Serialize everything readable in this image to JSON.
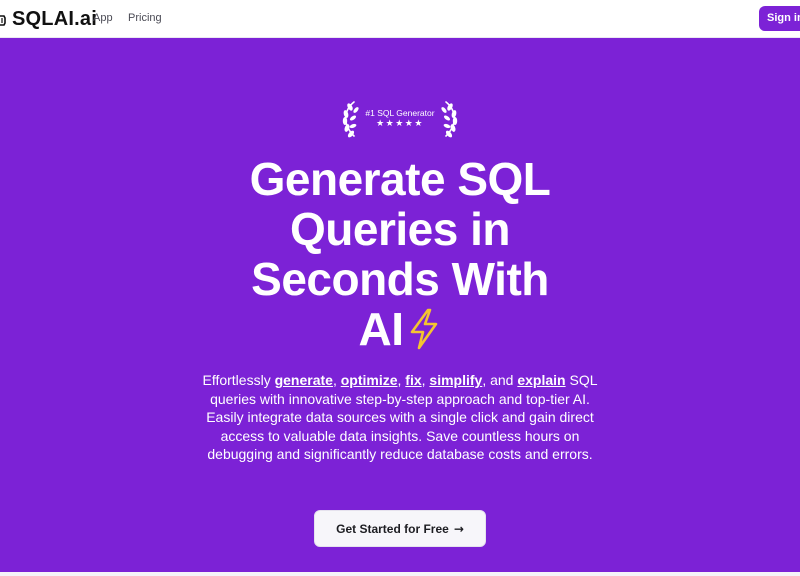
{
  "nav": {
    "brand": "SQLAI.ai",
    "links": [
      {
        "label": "App"
      },
      {
        "label": "Pricing"
      }
    ],
    "signin_label": "Sign in",
    "icons": {
      "brand": "logo-icon"
    }
  },
  "hero": {
    "award_label": "#1 SQL Generator",
    "award_stars": "★★★★★",
    "headline_lines": [
      "Generate SQL",
      "Queries in",
      "Seconds With",
      "AI"
    ],
    "headline_icon": "lightning-bolt-icon",
    "description": {
      "prefix": "Effortlessly ",
      "k1": "generate",
      "sep1": ", ",
      "k2": "optimize",
      "sep2": ", ",
      "k3": "fix",
      "sep3": ", ",
      "k4": "simplify",
      "sep4": ", and ",
      "k5": "explain",
      "suffix": " SQL queries with innovative step-by-step approach and top-tier AI. Easily integrate data sources with a single click and gain direct access to valuable data insights. Save countless hours on debugging and significantly reduce database costs and errors."
    },
    "cta_label": "Get Started for Free",
    "cta_arrow": "→"
  },
  "colors": {
    "brand_purple": "#7c22d6",
    "bolt_yellow": "#f4c430",
    "cta_bg": "#f7f6fa"
  }
}
